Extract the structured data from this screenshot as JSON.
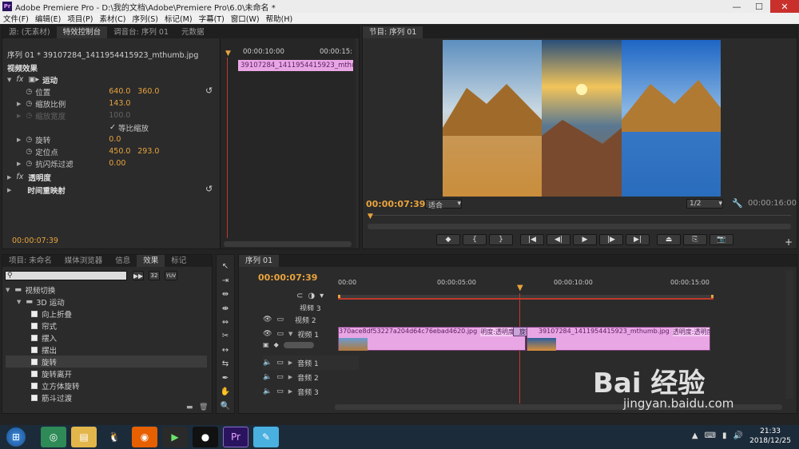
{
  "window": {
    "app_icon": "Pr",
    "title": "Adobe Premiere Pro - D:\\我的文档\\Adobe\\Premiere Pro\\6.0\\未命名 *",
    "min": "—",
    "max": "☐",
    "close": "✕"
  },
  "menu": [
    "文件(F)",
    "编辑(E)",
    "项目(P)",
    "素材(C)",
    "序列(S)",
    "标记(M)",
    "字幕(T)",
    "窗口(W)",
    "帮助(H)"
  ],
  "effect_controls": {
    "tabs": [
      "源: (无素材)",
      "特效控制台",
      "调音台: 序列 01",
      "元数据"
    ],
    "sequence_label": "序列 01 * 39107284_1411954415923_mthumb.jpg",
    "ruler_time": "00:00:10:00",
    "ruler_time2": "00:00:15:",
    "clip_name": "39107284_1411954415923_mthumb.jpg",
    "section": "视频效果",
    "motion": "运动",
    "props": [
      {
        "name": "位置",
        "v1": "640.0",
        "v2": "360.0"
      },
      {
        "name": "缩放比例",
        "v1": "143.0",
        "v2": ""
      },
      {
        "name": "缩放宽度",
        "v1": "100.0",
        "v2": ""
      },
      {
        "name": "旋转",
        "v1": "0.0",
        "v2": ""
      },
      {
        "name": "定位点",
        "v1": "450.0",
        "v2": "293.0"
      },
      {
        "name": "抗闪烁过滤",
        "v1": "0.00",
        "v2": ""
      }
    ],
    "uniform_scale": "等比缩放",
    "opacity": "透明度",
    "time_remap": "时间重映射",
    "current_time": "00:00:07:39"
  },
  "program": {
    "tab": "节目: 序列 01",
    "timecode": "00:00:07:39",
    "fit": "适合",
    "res": "1/2",
    "duration": "00:00:16:00"
  },
  "project": {
    "tabs": [
      "项目: 未命名",
      "媒体浏览器",
      "信息",
      "效果",
      "标记"
    ],
    "search_placeholder": "",
    "badges": [
      "32",
      "YUV"
    ],
    "tree": [
      {
        "label": "视频切换",
        "level": 0,
        "type": "folder"
      },
      {
        "label": "3D 运动",
        "level": 1,
        "type": "folder"
      },
      {
        "label": "向上折叠",
        "level": 2,
        "type": "item"
      },
      {
        "label": "帘式",
        "level": 2,
        "type": "item"
      },
      {
        "label": "摆入",
        "level": 2,
        "type": "item"
      },
      {
        "label": "摆出",
        "level": 2,
        "type": "item"
      },
      {
        "label": "旋转",
        "level": 2,
        "type": "item"
      },
      {
        "label": "旋转离开",
        "level": 2,
        "type": "item"
      },
      {
        "label": "立方体旋转",
        "level": 2,
        "type": "item"
      },
      {
        "label": "筋斗过渡",
        "level": 2,
        "type": "item"
      }
    ]
  },
  "timeline": {
    "tab": "序列 01",
    "timecode": "00:00:07:39",
    "ruler": [
      "00:00",
      "00:00:05:00",
      "00:00:10:00",
      "00:00:15:00"
    ],
    "tracks": {
      "v3": "视频 3",
      "v2": "视频 2",
      "v1": "视频 1",
      "a1": "音频 1",
      "a2": "音频 2",
      "a3": "音频 3"
    },
    "clip1": "370ace8df53227a204d64c76ebad4620.jpg",
    "clip1_opacity": "明度:透明度",
    "transition": "旋转",
    "clip2": "39107284_1411954415923_mthumb.jpg",
    "clip2_opacity": "透明度:透明度"
  },
  "taskbar": {
    "time": "21:33",
    "date": "2018/12/25"
  },
  "watermark": {
    "brand": "Bai 经验",
    "url": "jingyan.baidu.com"
  }
}
